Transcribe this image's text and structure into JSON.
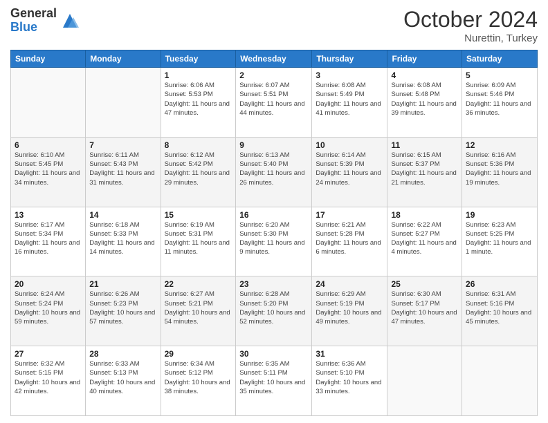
{
  "header": {
    "logo_general": "General",
    "logo_blue": "Blue",
    "month": "October 2024",
    "location": "Nurettin, Turkey"
  },
  "days_header": [
    "Sunday",
    "Monday",
    "Tuesday",
    "Wednesday",
    "Thursday",
    "Friday",
    "Saturday"
  ],
  "weeks": [
    [
      {
        "day": "",
        "info": ""
      },
      {
        "day": "",
        "info": ""
      },
      {
        "day": "1",
        "info": "Sunrise: 6:06 AM\nSunset: 5:53 PM\nDaylight: 11 hours and 47 minutes."
      },
      {
        "day": "2",
        "info": "Sunrise: 6:07 AM\nSunset: 5:51 PM\nDaylight: 11 hours and 44 minutes."
      },
      {
        "day": "3",
        "info": "Sunrise: 6:08 AM\nSunset: 5:49 PM\nDaylight: 11 hours and 41 minutes."
      },
      {
        "day": "4",
        "info": "Sunrise: 6:08 AM\nSunset: 5:48 PM\nDaylight: 11 hours and 39 minutes."
      },
      {
        "day": "5",
        "info": "Sunrise: 6:09 AM\nSunset: 5:46 PM\nDaylight: 11 hours and 36 minutes."
      }
    ],
    [
      {
        "day": "6",
        "info": "Sunrise: 6:10 AM\nSunset: 5:45 PM\nDaylight: 11 hours and 34 minutes."
      },
      {
        "day": "7",
        "info": "Sunrise: 6:11 AM\nSunset: 5:43 PM\nDaylight: 11 hours and 31 minutes."
      },
      {
        "day": "8",
        "info": "Sunrise: 6:12 AM\nSunset: 5:42 PM\nDaylight: 11 hours and 29 minutes."
      },
      {
        "day": "9",
        "info": "Sunrise: 6:13 AM\nSunset: 5:40 PM\nDaylight: 11 hours and 26 minutes."
      },
      {
        "day": "10",
        "info": "Sunrise: 6:14 AM\nSunset: 5:39 PM\nDaylight: 11 hours and 24 minutes."
      },
      {
        "day": "11",
        "info": "Sunrise: 6:15 AM\nSunset: 5:37 PM\nDaylight: 11 hours and 21 minutes."
      },
      {
        "day": "12",
        "info": "Sunrise: 6:16 AM\nSunset: 5:36 PM\nDaylight: 11 hours and 19 minutes."
      }
    ],
    [
      {
        "day": "13",
        "info": "Sunrise: 6:17 AM\nSunset: 5:34 PM\nDaylight: 11 hours and 16 minutes."
      },
      {
        "day": "14",
        "info": "Sunrise: 6:18 AM\nSunset: 5:33 PM\nDaylight: 11 hours and 14 minutes."
      },
      {
        "day": "15",
        "info": "Sunrise: 6:19 AM\nSunset: 5:31 PM\nDaylight: 11 hours and 11 minutes."
      },
      {
        "day": "16",
        "info": "Sunrise: 6:20 AM\nSunset: 5:30 PM\nDaylight: 11 hours and 9 minutes."
      },
      {
        "day": "17",
        "info": "Sunrise: 6:21 AM\nSunset: 5:28 PM\nDaylight: 11 hours and 6 minutes."
      },
      {
        "day": "18",
        "info": "Sunrise: 6:22 AM\nSunset: 5:27 PM\nDaylight: 11 hours and 4 minutes."
      },
      {
        "day": "19",
        "info": "Sunrise: 6:23 AM\nSunset: 5:25 PM\nDaylight: 11 hours and 1 minute."
      }
    ],
    [
      {
        "day": "20",
        "info": "Sunrise: 6:24 AM\nSunset: 5:24 PM\nDaylight: 10 hours and 59 minutes."
      },
      {
        "day": "21",
        "info": "Sunrise: 6:26 AM\nSunset: 5:23 PM\nDaylight: 10 hours and 57 minutes."
      },
      {
        "day": "22",
        "info": "Sunrise: 6:27 AM\nSunset: 5:21 PM\nDaylight: 10 hours and 54 minutes."
      },
      {
        "day": "23",
        "info": "Sunrise: 6:28 AM\nSunset: 5:20 PM\nDaylight: 10 hours and 52 minutes."
      },
      {
        "day": "24",
        "info": "Sunrise: 6:29 AM\nSunset: 5:19 PM\nDaylight: 10 hours and 49 minutes."
      },
      {
        "day": "25",
        "info": "Sunrise: 6:30 AM\nSunset: 5:17 PM\nDaylight: 10 hours and 47 minutes."
      },
      {
        "day": "26",
        "info": "Sunrise: 6:31 AM\nSunset: 5:16 PM\nDaylight: 10 hours and 45 minutes."
      }
    ],
    [
      {
        "day": "27",
        "info": "Sunrise: 6:32 AM\nSunset: 5:15 PM\nDaylight: 10 hours and 42 minutes."
      },
      {
        "day": "28",
        "info": "Sunrise: 6:33 AM\nSunset: 5:13 PM\nDaylight: 10 hours and 40 minutes."
      },
      {
        "day": "29",
        "info": "Sunrise: 6:34 AM\nSunset: 5:12 PM\nDaylight: 10 hours and 38 minutes."
      },
      {
        "day": "30",
        "info": "Sunrise: 6:35 AM\nSunset: 5:11 PM\nDaylight: 10 hours and 35 minutes."
      },
      {
        "day": "31",
        "info": "Sunrise: 6:36 AM\nSunset: 5:10 PM\nDaylight: 10 hours and 33 minutes."
      },
      {
        "day": "",
        "info": ""
      },
      {
        "day": "",
        "info": ""
      }
    ]
  ]
}
